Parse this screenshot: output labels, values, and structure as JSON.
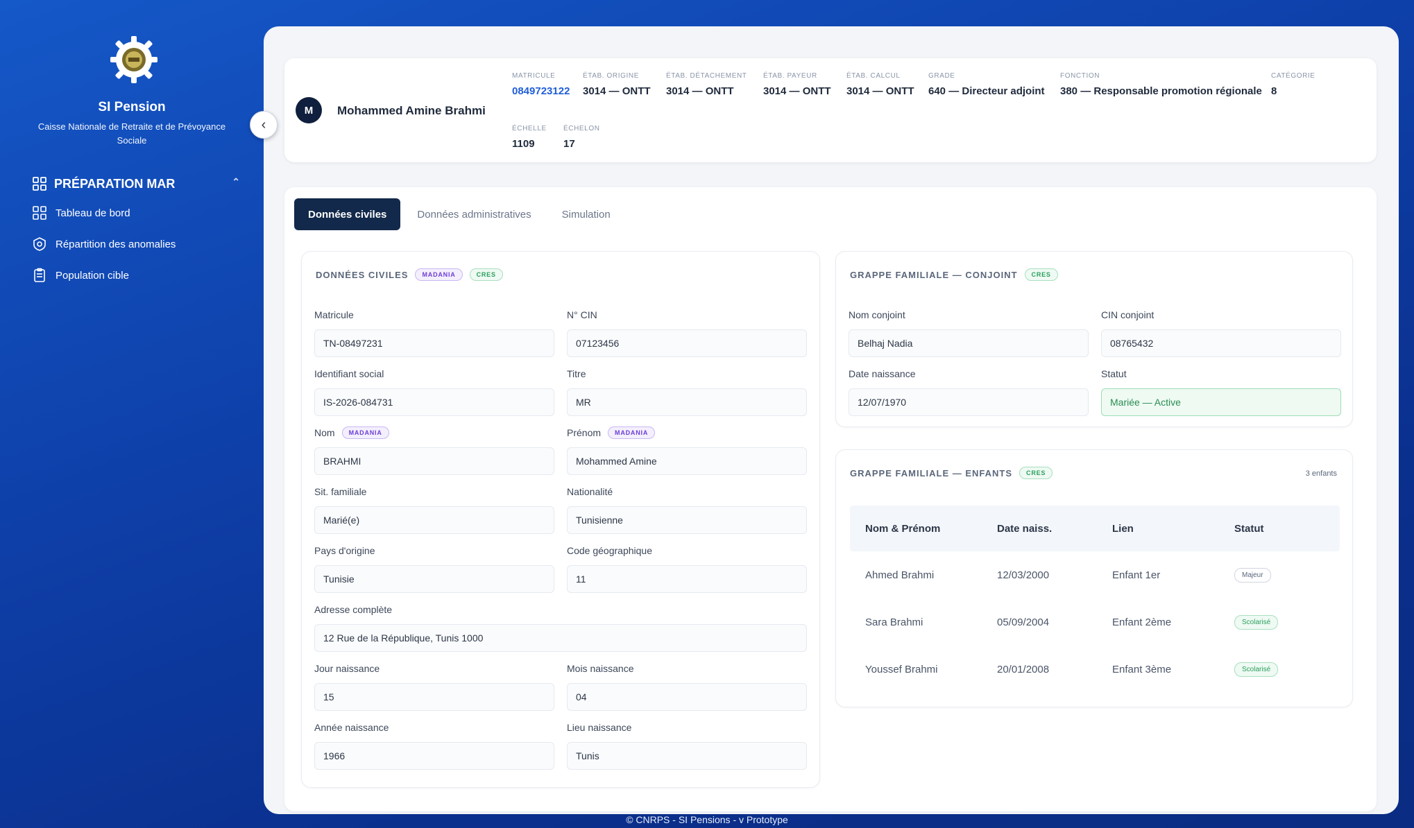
{
  "sidebar": {
    "brand_title": "SI Pension",
    "brand_subtitle": "Caisse Nationale de Retraite et de Prévoyance Sociale",
    "section": "PRÉPARATION MAR",
    "items": [
      {
        "label": "Tableau de bord",
        "icon": "dashboard-icon"
      },
      {
        "label": "Répartition des anomalies",
        "icon": "anomalies-icon"
      },
      {
        "label": "Population cible",
        "icon": "clipboard-icon"
      }
    ]
  },
  "header": {
    "avatar_initial": "M",
    "name": "Mohammed Amine Brahmi",
    "meta": [
      {
        "label": "MATRICULE",
        "value": "0849723122"
      },
      {
        "label": "ÉTAB. ORIGINE",
        "value": "3014 — ONTT"
      },
      {
        "label": "ÉTAB. DÉTACHEMENT",
        "value": "3014 — ONTT"
      },
      {
        "label": "ÉTAB. PAYEUR",
        "value": "3014 — ONTT"
      },
      {
        "label": "ÉTAB. CALCUL",
        "value": "3014 — ONTT"
      },
      {
        "label": "GRADE",
        "value": "640 — Directeur adjoint"
      },
      {
        "label": "FONCTION",
        "value": "380 — Responsable promotion régionale"
      },
      {
        "label": "CATÉGORIE",
        "value": "8"
      },
      {
        "label": "ÉCHELLE",
        "value": "1109"
      },
      {
        "label": "ÉCHELON",
        "value": "17"
      }
    ]
  },
  "tabs": [
    "Données civiles",
    "Données administratives",
    "Simulation"
  ],
  "civil": {
    "title": "DONNÉES CIVILES",
    "badge_madania": "MADANIA",
    "badge_cres": "CRES",
    "fields": {
      "matricule": {
        "label": "Matricule",
        "value": "TN-08497231"
      },
      "cin": {
        "label": "N° CIN",
        "value": "07123456"
      },
      "identifiant": {
        "label": "Identifiant social",
        "value": "IS-2026-084731"
      },
      "titre": {
        "label": "Titre",
        "value": "MR"
      },
      "nom": {
        "label": "Nom",
        "value": "BRAHMI"
      },
      "prenom": {
        "label": "Prénom",
        "value": "Mohammed Amine"
      },
      "sit_familiale": {
        "label": "Sit. familiale",
        "value": "Marié(e)"
      },
      "nationalite": {
        "label": "Nationalité",
        "value": "Tunisienne"
      },
      "pays": {
        "label": "Pays d'origine",
        "value": "Tunisie"
      },
      "code_geo": {
        "label": "Code géographique",
        "value": "11"
      },
      "adresse": {
        "label": "Adresse complète",
        "value": "12 Rue de la République, Tunis 1000"
      },
      "jour": {
        "label": "Jour naissance",
        "value": "15"
      },
      "mois": {
        "label": "Mois naissance",
        "value": "04"
      },
      "annee": {
        "label": "Année naissance",
        "value": "1966"
      },
      "lieu": {
        "label": "Lieu naissance",
        "value": "Tunis"
      }
    }
  },
  "spouse": {
    "title": "GRAPPE FAMILIALE — CONJOINT",
    "badge": "CRES",
    "fields": {
      "nom": {
        "label": "Nom conjoint",
        "value": "Belhaj Nadia"
      },
      "cin": {
        "label": "CIN conjoint",
        "value": "08765432"
      },
      "date": {
        "label": "Date naissance",
        "value": "12/07/1970"
      },
      "statut": {
        "label": "Statut",
        "value": "Mariée — Active"
      }
    }
  },
  "children": {
    "title": "GRAPPE FAMILIALE — ENFANTS",
    "badge": "CRES",
    "count": "3 enfants",
    "columns": [
      "Nom & Prénom",
      "Date naiss.",
      "Lien",
      "Statut"
    ],
    "rows": [
      {
        "name": "Ahmed Brahmi",
        "date": "12/03/2000",
        "lien": "Enfant 1er",
        "statut": "Majeur"
      },
      {
        "name": "Sara Brahmi",
        "date": "05/09/2004",
        "lien": "Enfant 2ème",
        "statut": "Scolarisé"
      },
      {
        "name": "Youssef Brahmi",
        "date": "20/01/2008",
        "lien": "Enfant 3ème",
        "statut": "Scolarisé"
      }
    ]
  },
  "footer": "© CNRPS - SI Pensions - v Prototype"
}
